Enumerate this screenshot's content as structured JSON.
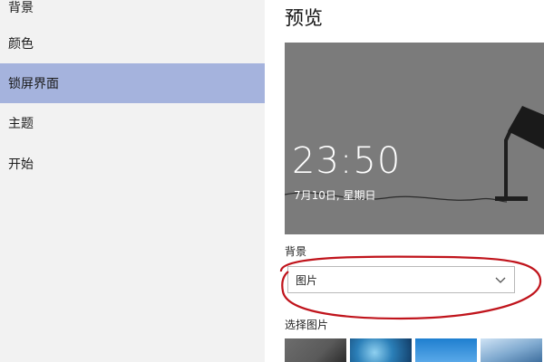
{
  "sidebar": {
    "items": [
      {
        "label": "背景"
      },
      {
        "label": "颜色"
      },
      {
        "label": "锁屏界面"
      },
      {
        "label": "主题"
      },
      {
        "label": "开始"
      }
    ]
  },
  "main": {
    "title": "预览",
    "preview": {
      "time": "23:50",
      "date": "7月10日, 星期日"
    },
    "background_label": "背景",
    "background_select": {
      "value": "图片",
      "icon": "chevron-down-icon"
    },
    "choose_picture_label": "选择图片",
    "thumbnails": [
      {
        "name": "dark-landscape"
      },
      {
        "name": "blue-ice"
      },
      {
        "name": "sky-blue"
      },
      {
        "name": "cloudy-sky"
      }
    ]
  },
  "colors": {
    "sidebar_bg": "#f2f2f2",
    "active_item_bg": "#a5b3dd",
    "preview_bg": "#7b7b7b",
    "annotation_red": "#c0141c"
  }
}
